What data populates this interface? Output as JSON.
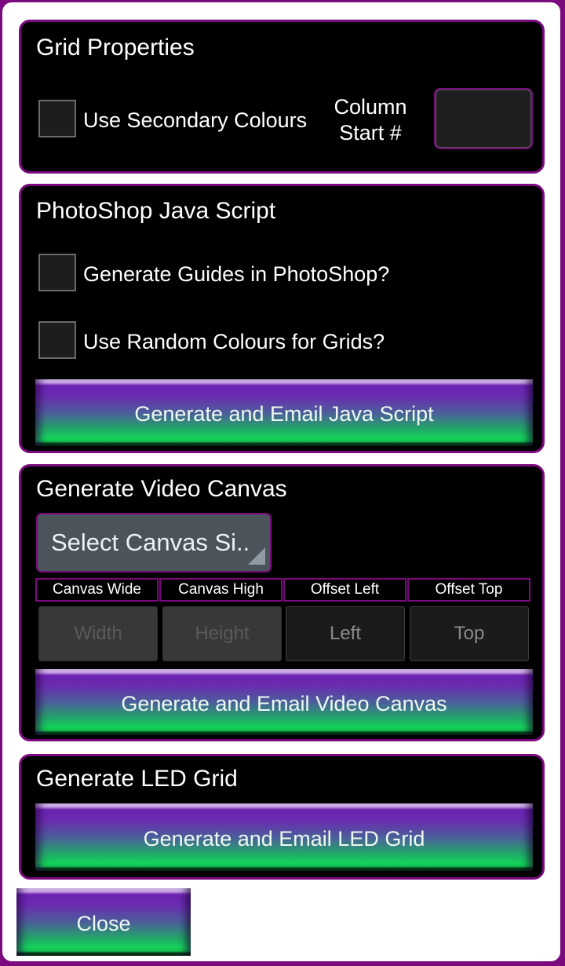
{
  "grid_properties": {
    "title": "Grid Properties",
    "use_secondary_colours": {
      "label": "Use Secondary Colours",
      "checked": false
    },
    "column_start": {
      "label": "Column Start #",
      "label_line1": "Column",
      "label_line2": "Start #",
      "value": ""
    }
  },
  "photoshop_script": {
    "title": "PhotoShop Java Script",
    "generate_guides": {
      "label": "Generate Guides in PhotoShop?",
      "checked": false
    },
    "random_colours": {
      "label": "Use Random Colours for Grids?",
      "checked": false
    },
    "button_label": "Generate and Email Java Script"
  },
  "video_canvas": {
    "title": "Generate Video Canvas",
    "canvas_size_select": {
      "selected": "Select Canvas Si.."
    },
    "columns": [
      {
        "header": "Canvas Wide",
        "placeholder": "Width",
        "value": "",
        "enabled": false
      },
      {
        "header": "Canvas High",
        "placeholder": "Height",
        "value": "",
        "enabled": false
      },
      {
        "header": "Offset Left",
        "placeholder": "Left",
        "value": "",
        "enabled": true
      },
      {
        "header": "Offset Top",
        "placeholder": "Top",
        "value": "",
        "enabled": true
      }
    ],
    "button_label": "Generate and Email Video Canvas"
  },
  "led_grid": {
    "title": "Generate LED Grid",
    "button_label": "Generate and Email LED Grid"
  },
  "close_label": "Close",
  "colors": {
    "accent_purple": "#7a0a7e",
    "button_top": "#6d22b2",
    "button_bottom": "#14d25a",
    "panel_bg": "#000000",
    "dialog_bg": "#ffffff"
  }
}
